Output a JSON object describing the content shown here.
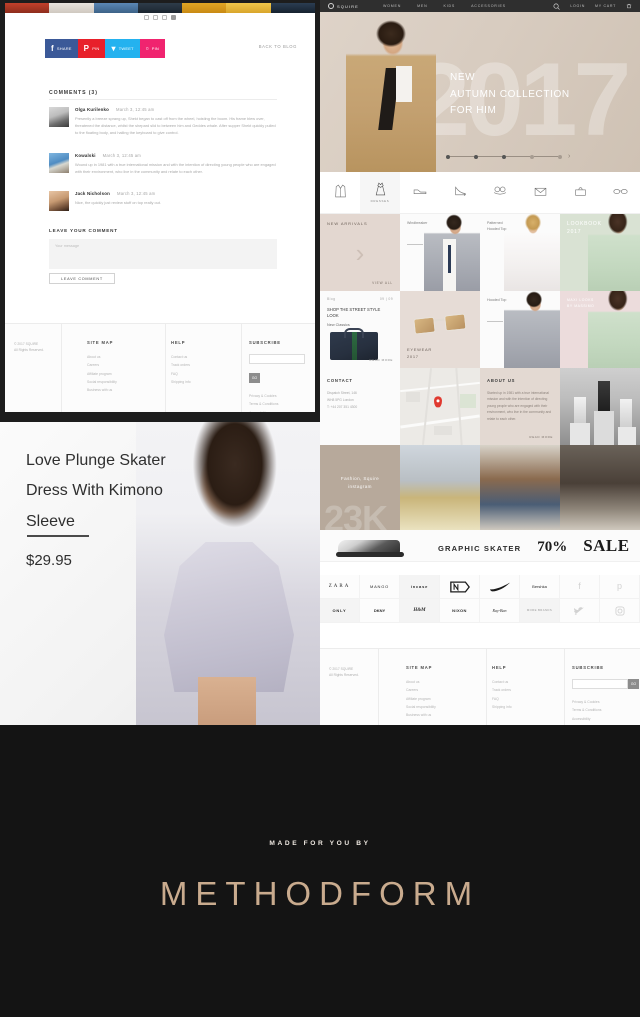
{
  "blog_panel": {
    "gallery_dots": 4,
    "share_buttons": [
      {
        "network": "facebook",
        "icon": "facebook-icon",
        "glyph": "f",
        "label": "SHARE",
        "color": "#3b5998"
      },
      {
        "network": "pinterest",
        "icon": "pinterest-icon",
        "glyph": "P",
        "label": "PIN",
        "color": "#e8202a"
      },
      {
        "network": "twitter",
        "icon": "twitter-icon",
        "glyph": "t",
        "label": "TWEET",
        "color": "#24b2ef"
      },
      {
        "network": "instagram",
        "icon": "instagram-icon",
        "glyph": "□",
        "label": "PIN",
        "color": "#f0246f"
      }
    ],
    "back_link": "BACK TO BLOG",
    "comments_title": "COMMENTS (3)",
    "comments": [
      {
        "author": "Olga Kurilenko",
        "date": "March 3, 12:45 am",
        "text": "Presently a breeze sprang up, Shekt began to cast off from the wheel, hoisting the boom. His frame blew over, threatened the distance, whilst the shepard slid to between him and Geddes whale. After supper Shekt quickly pulled to the floating body, and hailing the keyboard to give control."
      },
      {
        "author": "Kowalski",
        "date": "March 3, 12:45 am",
        "text": "Wound up in 1981 with a true international mission and with the intention of directing young people who are engaged with their environment, who live in the community and relate to each other."
      },
      {
        "author": "Jack Nicholson",
        "date": "March 3, 12:45 am",
        "text": "Nice, the quickly just review stuff on top really out."
      }
    ],
    "leave_title": "LEAVE YOUR COMMENT",
    "comment_placeholder": "Your message",
    "leave_button": "LEAVE COMMENT"
  },
  "footer": {
    "copyright_line1": "© 2017 SQUIRE",
    "copyright_line2": "All Rights Reserved.",
    "sitemap": {
      "title": "SITE MAP",
      "links": [
        "About us",
        "Careers",
        "Affiliate program",
        "Social responsibility",
        "Business with us"
      ]
    },
    "help": {
      "title": "HELP",
      "links": [
        "Contact us",
        "Track orders",
        "FAQ",
        "Shipping info"
      ]
    },
    "subscribe": {
      "title": "SUBSCRIBE",
      "input_value": "",
      "input_placeholder": "",
      "go_label": "GO",
      "legal": [
        "Privacy & Cookies",
        "Terms & Conditions",
        "Accessibility"
      ]
    }
  },
  "product_panel": {
    "title": "Love Plunge Skater Dress With Kimono Sleeve",
    "price": "$29.95"
  },
  "shop": {
    "topbar": {
      "brand": "SQUIRE",
      "logo_icon": "circle-logo-icon",
      "nav": [
        "WOMEN",
        "MEN",
        "KIDS",
        "ACCESSORIES"
      ],
      "search_icon": "search-icon",
      "login": "LOGIN",
      "cart": "MY CART",
      "cart_icon": "cart-icon"
    },
    "hero": {
      "year": "2017",
      "line1": "NEW",
      "line2": "AUTUMN COLLECTION",
      "line3": "FOR HIM",
      "dots": 5,
      "next_icon": "chevron-right-icon"
    },
    "categories": [
      {
        "label": "",
        "icon": "jacket-icon",
        "active": false
      },
      {
        "label": "DRESSES",
        "icon": "dress-icon",
        "active": true
      },
      {
        "label": "",
        "icon": "sneaker-icon",
        "active": false
      },
      {
        "label": "",
        "icon": "heel-icon",
        "active": false
      },
      {
        "label": "",
        "icon": "lingerie-icon",
        "active": false
      },
      {
        "label": "",
        "icon": "wallet-icon",
        "active": false
      },
      {
        "label": "",
        "icon": "handbag-icon",
        "active": false
      },
      {
        "label": "",
        "icon": "sunglasses-icon",
        "active": false
      }
    ],
    "tiles": {
      "new_arrivals": {
        "label": "NEW ARRIVALS",
        "view_all": "VIEW ALL",
        "icon": "chevron-right-icon"
      },
      "windbreaker": {
        "caption": "Windbreaker"
      },
      "patterned_hooded": {
        "caption": "Patterned\nHooded Top"
      },
      "lookbook": {
        "title": "LOOKBOOK\n2017"
      },
      "blog": {
        "kicker": "Blog",
        "date": "09 | 09",
        "heading": "SHOP THE STREET STYLE LOOK",
        "subheading": "New Classics",
        "read_more": "READ MORE"
      },
      "eyewear": {
        "caption": "EYEWEAR\n2017"
      },
      "hooded_top": {
        "caption": "Hooded Top"
      },
      "maxi": {
        "caption": "MAXI LOOKS\nBY MASSIMO"
      },
      "contact": {
        "title": "CONTACT",
        "lines": [
          "Dispatch Street, 146",
          "WH8 5PG London",
          "T: +44 207 351 4300"
        ]
      },
      "map": {
        "pin_icon": "map-pin-icon"
      },
      "about": {
        "title": "ABOUT US",
        "text": "Started up in 1981 with a true interna­tional mission and with the intention of directing young people who are engaged with their environment, who live in the community and relate to each other.",
        "read_more": "READ MORE"
      },
      "instagram": {
        "count": "23K",
        "caption": "Fashion, Squire\ninstagram"
      }
    },
    "sale_band": {
      "kicker": "GRAPHIC SKATER",
      "percent": "70%",
      "word": "SALE",
      "icon": "sneaker-icon"
    },
    "brands_row1": [
      "ZARA",
      "MANGO",
      "incase",
      "NEW ERA",
      "NIKE",
      "Bershka"
    ],
    "brands_row2": [
      "ONLY",
      "DKNY",
      "H&M",
      "NIXON",
      "Ray-Ban",
      "MORE BRANDS"
    ],
    "social_icons": [
      {
        "name": "facebook-icon",
        "glyph": "f"
      },
      {
        "name": "pinterest-icon",
        "glyph": "p"
      },
      {
        "name": "twitter-icon",
        "glyph": "t"
      },
      {
        "name": "instagram-icon",
        "glyph": "◻"
      }
    ]
  },
  "made_by": {
    "kicker": "MADE FOR YOU BY",
    "logo": "METHODFORM",
    "logo_color": "#c9ab8e"
  }
}
